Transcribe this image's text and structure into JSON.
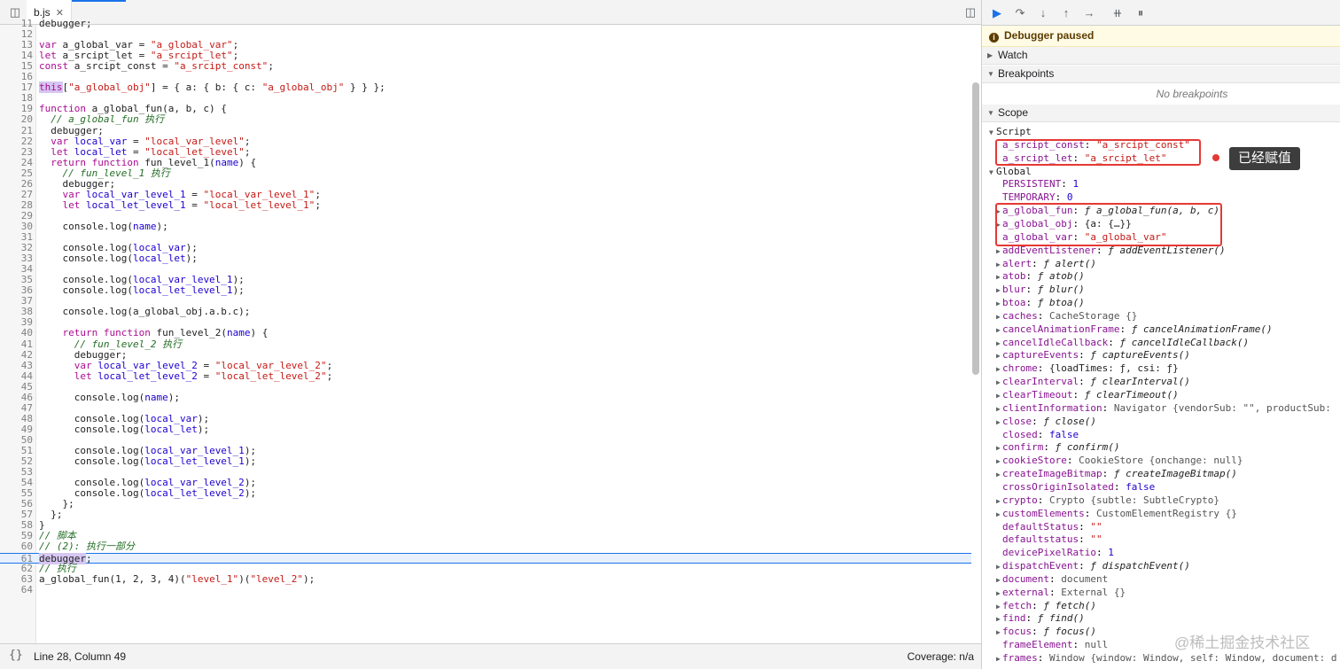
{
  "editor": {
    "tab_name": "b.js",
    "tab_close": "✕",
    "lines": [
      {
        "n": "11",
        "t": "debugger;"
      },
      {
        "n": "12",
        "t": ""
      },
      {
        "n": "13",
        "t": "var a_global_var = \"a_global_var\";"
      },
      {
        "n": "14",
        "t": "let a_srcipt_let = \"a_srcipt_let\";"
      },
      {
        "n": "15",
        "t": "const a_srcipt_const = \"a_srcipt_const\";"
      },
      {
        "n": "16",
        "t": ""
      },
      {
        "n": "17",
        "t": "this[\"a_global_obj\"] = { a: { b: { c: \"a_global_obj\" } } };"
      },
      {
        "n": "18",
        "t": ""
      },
      {
        "n": "19",
        "t": "function a_global_fun(a, b, c) {"
      },
      {
        "n": "20",
        "t": "  // a_global_fun 执行"
      },
      {
        "n": "21",
        "t": "  debugger;"
      },
      {
        "n": "22",
        "t": "  var local_var = \"local_var_level\";"
      },
      {
        "n": "23",
        "t": "  let local_let = \"local_let_level\";"
      },
      {
        "n": "24",
        "t": "  return function fun_level_1(name) {"
      },
      {
        "n": "25",
        "t": "    // fun_level_1 执行"
      },
      {
        "n": "26",
        "t": "    debugger;"
      },
      {
        "n": "27",
        "t": "    var local_var_level_1 = \"local_var_level_1\";"
      },
      {
        "n": "28",
        "t": "    let local_let_level_1 = \"local_let_level_1\";"
      },
      {
        "n": "29",
        "t": ""
      },
      {
        "n": "30",
        "t": "    console.log(name);"
      },
      {
        "n": "31",
        "t": ""
      },
      {
        "n": "32",
        "t": "    console.log(local_var);"
      },
      {
        "n": "33",
        "t": "    console.log(local_let);"
      },
      {
        "n": "34",
        "t": ""
      },
      {
        "n": "35",
        "t": "    console.log(local_var_level_1);"
      },
      {
        "n": "36",
        "t": "    console.log(local_let_level_1);"
      },
      {
        "n": "37",
        "t": ""
      },
      {
        "n": "38",
        "t": "    console.log(a_global_obj.a.b.c);"
      },
      {
        "n": "39",
        "t": ""
      },
      {
        "n": "40",
        "t": "    return function fun_level_2(name) {"
      },
      {
        "n": "41",
        "t": "      // fun_level_2 执行"
      },
      {
        "n": "42",
        "t": "      debugger;"
      },
      {
        "n": "43",
        "t": "      var local_var_level_2 = \"local_var_level_2\";"
      },
      {
        "n": "44",
        "t": "      let local_let_level_2 = \"local_let_level_2\";"
      },
      {
        "n": "45",
        "t": ""
      },
      {
        "n": "46",
        "t": "      console.log(name);"
      },
      {
        "n": "47",
        "t": ""
      },
      {
        "n": "48",
        "t": "      console.log(local_var);"
      },
      {
        "n": "49",
        "t": "      console.log(local_let);"
      },
      {
        "n": "50",
        "t": ""
      },
      {
        "n": "51",
        "t": "      console.log(local_var_level_1);"
      },
      {
        "n": "52",
        "t": "      console.log(local_let_level_1);"
      },
      {
        "n": "53",
        "t": ""
      },
      {
        "n": "54",
        "t": "      console.log(local_var_level_2);"
      },
      {
        "n": "55",
        "t": "      console.log(local_let_level_2);"
      },
      {
        "n": "56",
        "t": "    };"
      },
      {
        "n": "57",
        "t": "  };"
      },
      {
        "n": "58",
        "t": "}"
      },
      {
        "n": "59",
        "t": "// 脚本"
      },
      {
        "n": "60",
        "t": "// (2): 执行一部分"
      },
      {
        "n": "61",
        "t": "debugger;"
      },
      {
        "n": "62",
        "t": "// 执行"
      },
      {
        "n": "63",
        "t": "a_global_fun(1, 2, 3, 4)(\"level_1\")(\"level_2\");"
      },
      {
        "n": "64",
        "t": ""
      }
    ],
    "exec_line": "61",
    "status_position": "Line 28, Column 49",
    "status_coverage": "Coverage: n/a",
    "status_braces": "{}"
  },
  "debugger": {
    "paused_text": "Debugger paused",
    "sections": {
      "watch": "Watch",
      "breakpoints": "Breakpoints",
      "scope": "Scope"
    },
    "no_breakpoints": "No breakpoints",
    "scope_rows": [
      {
        "kind": "group",
        "label": "Script",
        "expand": true,
        "indent": 0
      },
      {
        "kind": "prop",
        "name": "a_srcipt_const",
        "value": "\"a_srcipt_const\"",
        "vtype": "str",
        "indent": 1
      },
      {
        "kind": "prop",
        "name": "a_srcipt_let",
        "value": "\"a_srcipt_let\"",
        "vtype": "str",
        "indent": 1
      },
      {
        "kind": "group",
        "label": "Global",
        "expand": true,
        "indent": 0
      },
      {
        "kind": "prop",
        "name": "PERSISTENT",
        "value": "1",
        "vtype": "num",
        "indent": 1
      },
      {
        "kind": "prop",
        "name": "TEMPORARY",
        "value": "0",
        "vtype": "num",
        "indent": 1
      },
      {
        "kind": "prop",
        "name": "a_global_fun",
        "value": "ƒ a_global_fun(a, b, c)",
        "vtype": "fn",
        "indent": 1,
        "expand": true
      },
      {
        "kind": "prop",
        "name": "a_global_obj",
        "value": "{a: {…}}",
        "vtype": "val",
        "indent": 1,
        "expand": true
      },
      {
        "kind": "prop",
        "name": "a_global_var",
        "value": "\"a_global_var\"",
        "vtype": "str",
        "indent": 1
      },
      {
        "kind": "prop",
        "name": "addEventListener",
        "value": "ƒ addEventListener()",
        "vtype": "fn",
        "indent": 1,
        "expand": true
      },
      {
        "kind": "prop",
        "name": "alert",
        "value": "ƒ alert()",
        "vtype": "fn",
        "indent": 1,
        "expand": true
      },
      {
        "kind": "prop",
        "name": "atob",
        "value": "ƒ atob()",
        "vtype": "fn",
        "indent": 1,
        "expand": true
      },
      {
        "kind": "prop",
        "name": "blur",
        "value": "ƒ blur()",
        "vtype": "fn",
        "indent": 1,
        "expand": true
      },
      {
        "kind": "prop",
        "name": "btoa",
        "value": "ƒ btoa()",
        "vtype": "fn",
        "indent": 1,
        "expand": true
      },
      {
        "kind": "prop",
        "name": "caches",
        "value": "CacheStorage {}",
        "vtype": "obj",
        "indent": 1,
        "expand": true
      },
      {
        "kind": "prop",
        "name": "cancelAnimationFrame",
        "value": "ƒ cancelAnimationFrame()",
        "vtype": "fn",
        "indent": 1,
        "expand": true
      },
      {
        "kind": "prop",
        "name": "cancelIdleCallback",
        "value": "ƒ cancelIdleCallback()",
        "vtype": "fn",
        "indent": 1,
        "expand": true
      },
      {
        "kind": "prop",
        "name": "captureEvents",
        "value": "ƒ captureEvents()",
        "vtype": "fn",
        "indent": 1,
        "expand": true
      },
      {
        "kind": "prop",
        "name": "chrome",
        "value": "{loadTimes: ƒ, csi: ƒ}",
        "vtype": "val",
        "indent": 1,
        "expand": true
      },
      {
        "kind": "prop",
        "name": "clearInterval",
        "value": "ƒ clearInterval()",
        "vtype": "fn",
        "indent": 1,
        "expand": true
      },
      {
        "kind": "prop",
        "name": "clearTimeout",
        "value": "ƒ clearTimeout()",
        "vtype": "fn",
        "indent": 1,
        "expand": true
      },
      {
        "kind": "prop",
        "name": "clientInformation",
        "value": "Navigator {vendorSub: \"\", productSub:",
        "vtype": "obj",
        "indent": 1,
        "expand": true
      },
      {
        "kind": "prop",
        "name": "close",
        "value": "ƒ close()",
        "vtype": "fn",
        "indent": 1,
        "expand": true
      },
      {
        "kind": "prop",
        "name": "closed",
        "value": "false",
        "vtype": "num",
        "indent": 1
      },
      {
        "kind": "prop",
        "name": "confirm",
        "value": "ƒ confirm()",
        "vtype": "fn",
        "indent": 1,
        "expand": true
      },
      {
        "kind": "prop",
        "name": "cookieStore",
        "value": "CookieStore {onchange: null}",
        "vtype": "obj",
        "indent": 1,
        "expand": true
      },
      {
        "kind": "prop",
        "name": "createImageBitmap",
        "value": "ƒ createImageBitmap()",
        "vtype": "fn",
        "indent": 1,
        "expand": true
      },
      {
        "kind": "prop",
        "name": "crossOriginIsolated",
        "value": "false",
        "vtype": "num",
        "indent": 1
      },
      {
        "kind": "prop",
        "name": "crypto",
        "value": "Crypto {subtle: SubtleCrypto}",
        "vtype": "obj",
        "indent": 1,
        "expand": true
      },
      {
        "kind": "prop",
        "name": "customElements",
        "value": "CustomElementRegistry {}",
        "vtype": "obj",
        "indent": 1,
        "expand": true
      },
      {
        "kind": "prop",
        "name": "defaultStatus",
        "value": "\"\"",
        "vtype": "str",
        "indent": 1
      },
      {
        "kind": "prop",
        "name": "defaultstatus",
        "value": "\"\"",
        "vtype": "str",
        "indent": 1
      },
      {
        "kind": "prop",
        "name": "devicePixelRatio",
        "value": "1",
        "vtype": "num",
        "indent": 1
      },
      {
        "kind": "prop",
        "name": "dispatchEvent",
        "value": "ƒ dispatchEvent()",
        "vtype": "fn",
        "indent": 1,
        "expand": true
      },
      {
        "kind": "prop",
        "name": "document",
        "value": "document",
        "vtype": "obj",
        "indent": 1,
        "expand": true
      },
      {
        "kind": "prop",
        "name": "external",
        "value": "External {}",
        "vtype": "obj",
        "indent": 1,
        "expand": true
      },
      {
        "kind": "prop",
        "name": "fetch",
        "value": "ƒ fetch()",
        "vtype": "fn",
        "indent": 1,
        "expand": true
      },
      {
        "kind": "prop",
        "name": "find",
        "value": "ƒ find()",
        "vtype": "fn",
        "indent": 1,
        "expand": true
      },
      {
        "kind": "prop",
        "name": "focus",
        "value": "ƒ focus()",
        "vtype": "fn",
        "indent": 1,
        "expand": true
      },
      {
        "kind": "prop",
        "name": "frameElement",
        "value": "null",
        "vtype": "obj",
        "indent": 1
      },
      {
        "kind": "prop",
        "name": "frames",
        "value": "Window {window: Window, self: Window, document: d",
        "vtype": "obj",
        "indent": 1,
        "expand": true
      }
    ],
    "callout": "已经赋值"
  },
  "watermark": "@稀土掘金技术社区",
  "colors": {
    "accent": "#1a73e8",
    "annotation_red": "#e53935"
  }
}
